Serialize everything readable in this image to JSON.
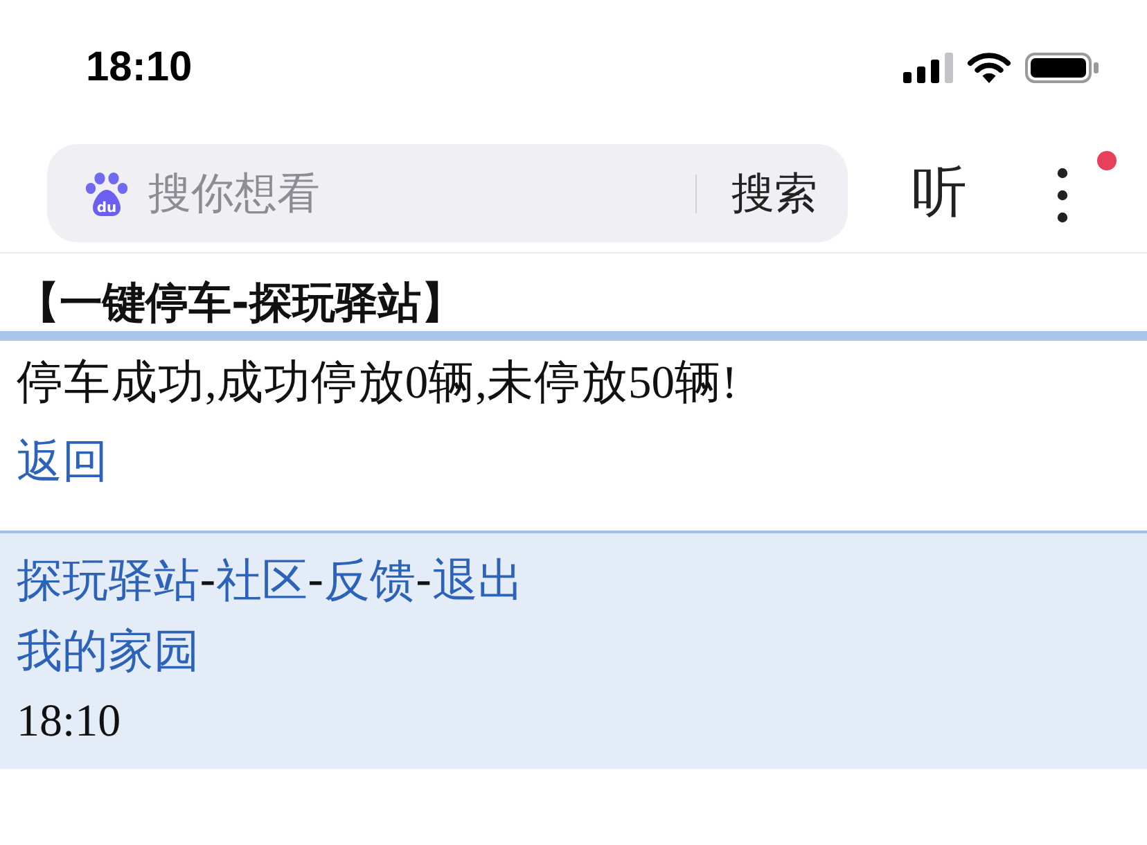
{
  "status_bar": {
    "time": "18:10"
  },
  "browser_bar": {
    "search": {
      "logo_text": "du",
      "placeholder": "搜你想看",
      "button": "搜索"
    },
    "listen_button": "听",
    "menu": {
      "notification_dot": true
    }
  },
  "page": {
    "title": "【一键停车-探玩驿站】",
    "message": "停车成功,成功停放0辆,未停放50辆!",
    "back_link": "返回"
  },
  "footer": {
    "nav": [
      {
        "kind": "link",
        "text": "探玩驿站"
      },
      {
        "kind": "separator",
        "text": "-"
      },
      {
        "kind": "link",
        "text": "社区"
      },
      {
        "kind": "separator",
        "text": "-"
      },
      {
        "kind": "link",
        "text": "反馈"
      },
      {
        "kind": "separator",
        "text": "-"
      },
      {
        "kind": "link",
        "text": "退出"
      }
    ],
    "home_link": "我的家园",
    "time": "18:10"
  }
}
